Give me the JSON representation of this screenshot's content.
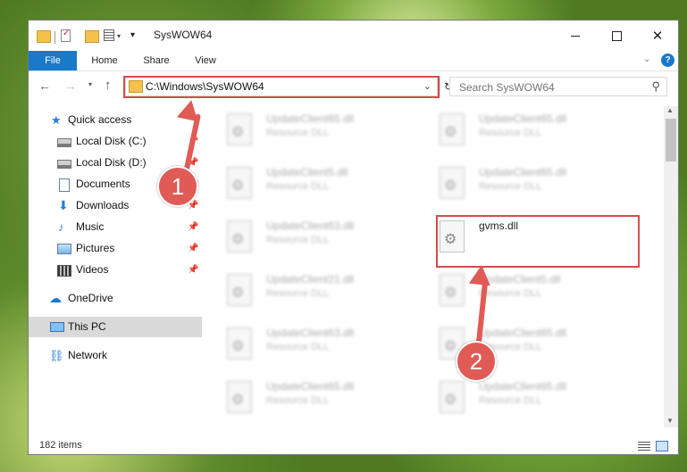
{
  "window": {
    "title": "SysWOW64"
  },
  "ribbon": {
    "tabs": [
      "File",
      "Home",
      "Share",
      "View"
    ]
  },
  "address": {
    "path": "C:\\Windows\\SysWOW64"
  },
  "search": {
    "placeholder": "Search SysWOW64"
  },
  "sidebar": {
    "items": [
      {
        "label": "Quick access",
        "icon": "star-icon",
        "pinned": false
      },
      {
        "label": "Local Disk (C:)",
        "icon": "drive-icon",
        "pinned": true
      },
      {
        "label": "Local Disk (D:)",
        "icon": "drive-icon",
        "pinned": true
      },
      {
        "label": "Documents",
        "icon": "documents-icon",
        "pinned": true
      },
      {
        "label": "Downloads",
        "icon": "download-icon",
        "pinned": true
      },
      {
        "label": "Music",
        "icon": "music-icon",
        "pinned": true
      },
      {
        "label": "Pictures",
        "icon": "pictures-icon",
        "pinned": true
      },
      {
        "label": "Videos",
        "icon": "videos-icon",
        "pinned": true
      },
      {
        "label": "OneDrive",
        "icon": "cloud-icon",
        "pinned": false
      },
      {
        "label": "This PC",
        "icon": "computer-icon",
        "pinned": false,
        "selected": true
      },
      {
        "label": "Network",
        "icon": "network-icon",
        "pinned": false
      }
    ]
  },
  "files": {
    "left": [
      {
        "name": "UpdateClient65.dll",
        "type": "Resource DLL"
      },
      {
        "name": "UpdateClient5.dll",
        "type": "Resource DLL"
      },
      {
        "name": "UpdateClient63.dll",
        "type": "Resource DLL"
      },
      {
        "name": "UpdateClient21.dll",
        "type": "Resource DLL"
      },
      {
        "name": "UpdateClient63.dll",
        "type": "Resource DLL"
      },
      {
        "name": "UpdateClient65.dll",
        "type": "Resource DLL"
      }
    ],
    "right": [
      {
        "name": "UpdateClient65.dll",
        "type": "Resource DLL"
      },
      {
        "name": "UpdateClient65.dll",
        "type": "Resource DLL"
      },
      {
        "name": "gvms.dll",
        "type": ""
      },
      {
        "name": "UpdateClient5.dll",
        "type": "Resource DLL"
      },
      {
        "name": "UpdateClient65.dll",
        "type": "Resource DLL"
      },
      {
        "name": "UpdateClient65.dll",
        "type": "Resource DLL"
      }
    ]
  },
  "status": {
    "item_count": "182 items"
  },
  "annotations": {
    "step1": "1",
    "step2": "2"
  },
  "colors": {
    "accent": "#1979ca",
    "highlight": "#d54b4b",
    "annotation": "#e05a56"
  }
}
